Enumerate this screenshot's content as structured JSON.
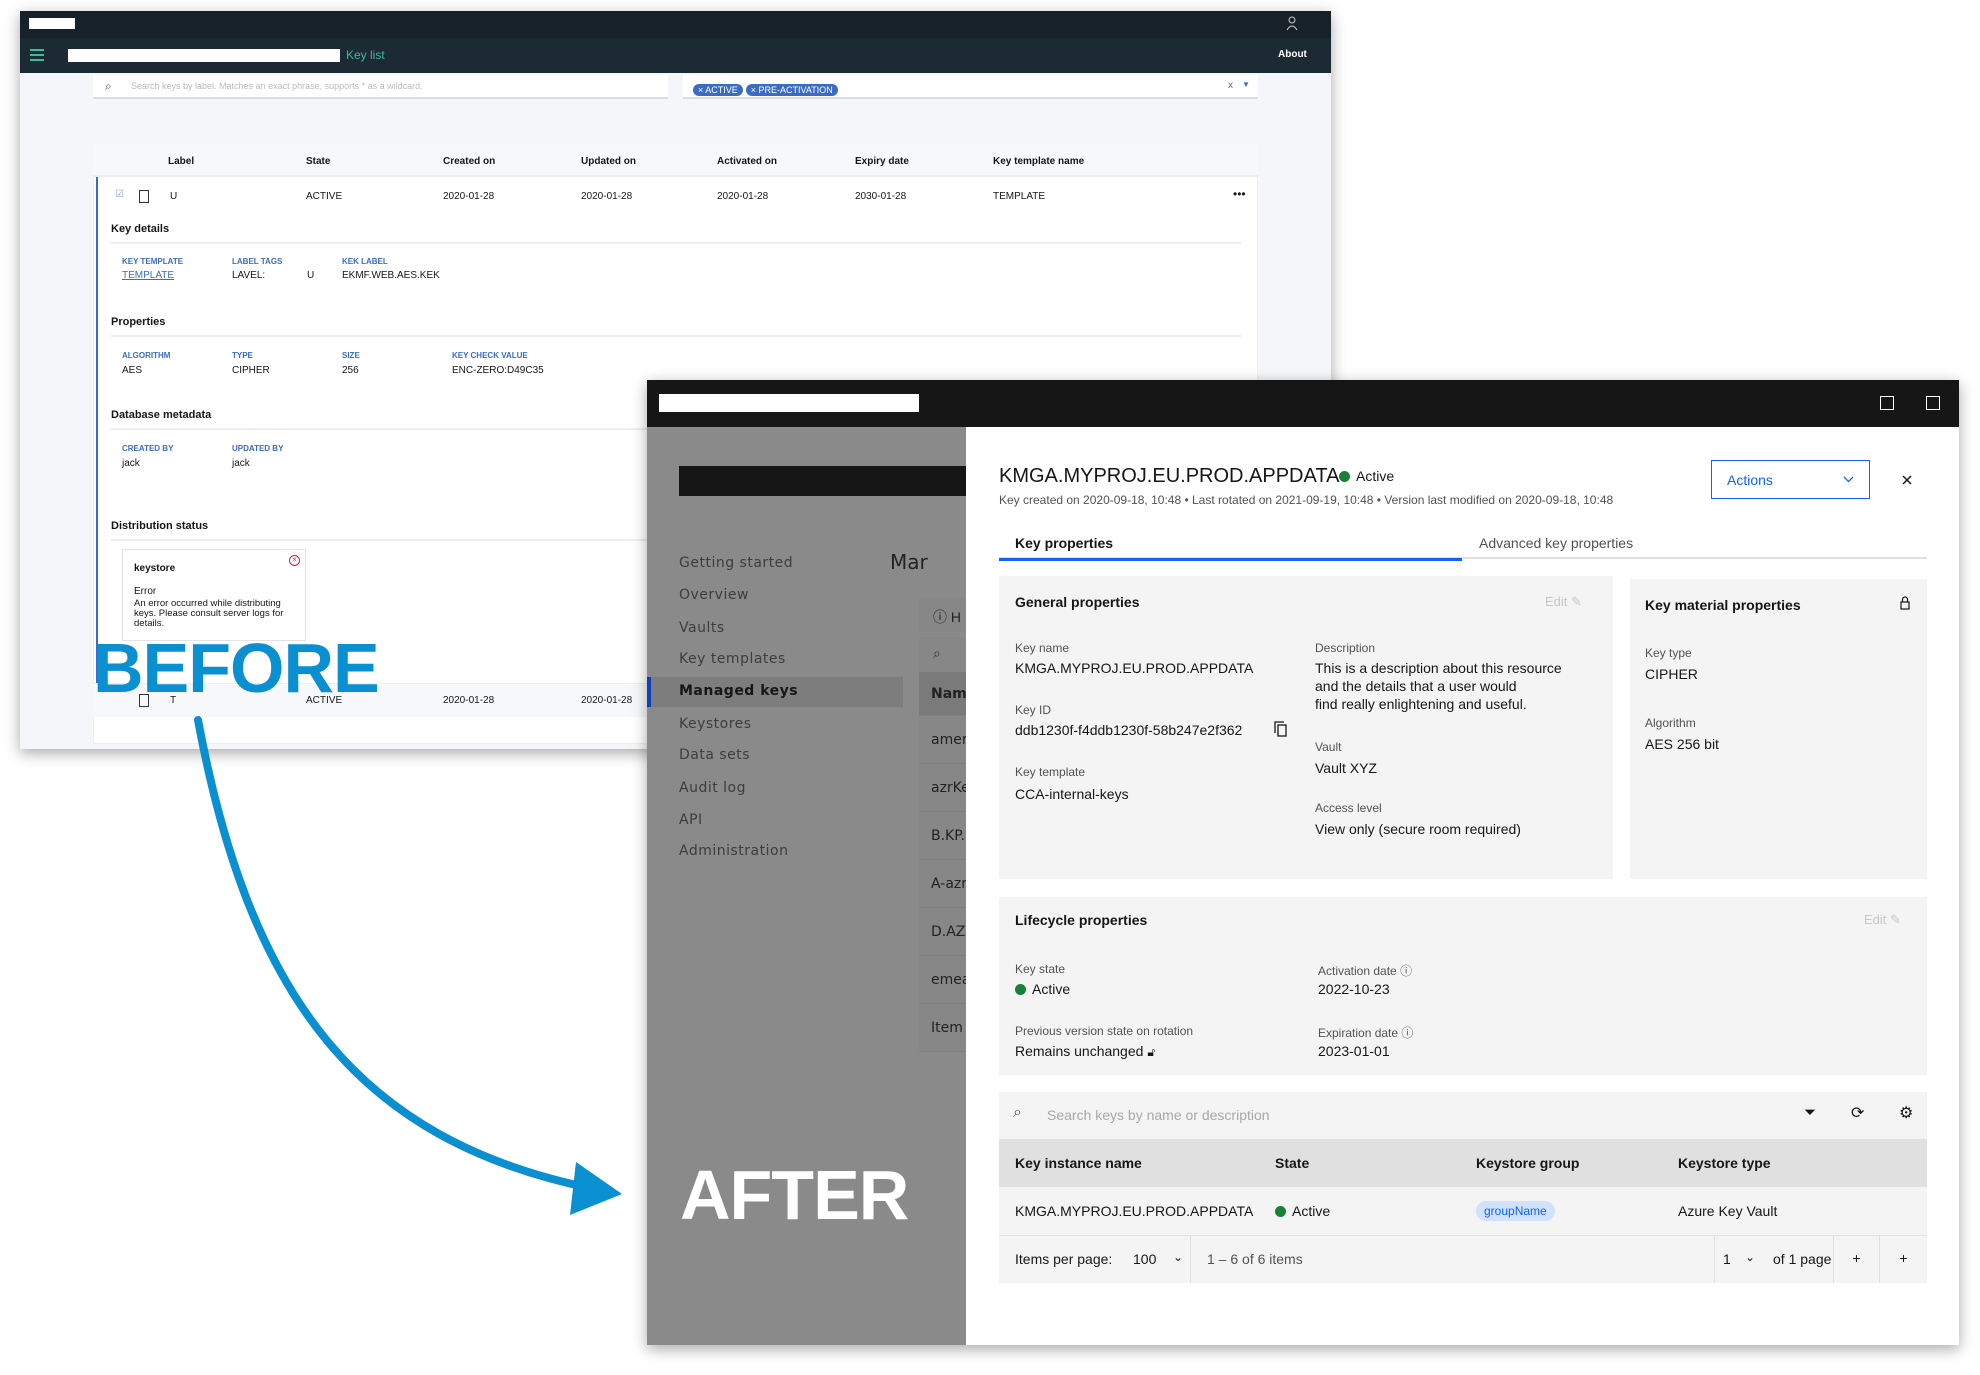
{
  "before": {
    "nav": {
      "title": "Key list",
      "about": "About",
      "icons": [
        "menu-icon",
        "user-icon"
      ]
    },
    "search_placeholder": "Search keys by label. Matches an exact phrase, supports * as a wildcard.",
    "filter_chips": [
      "× ACTIVE",
      "× PRE-ACTIVATION"
    ],
    "filter_clear": "x",
    "columns": [
      "Label",
      "State",
      "Created on",
      "Updated on",
      "Activated on",
      "Expiry date",
      "Key template name"
    ],
    "row": {
      "label": "U",
      "state": "ACTIVE",
      "created": "2020-01-28",
      "updated": "2020-01-28",
      "activated": "2020-01-28",
      "expiry": "2030-01-28",
      "template": "TEMPLATE",
      "menu": "•••"
    },
    "key_details": {
      "title": "Key details",
      "key_template_label": "KEY TEMPLATE",
      "key_template_value": "TEMPLATE",
      "label_tags_label": "LABEL TAGS",
      "label_tags_key": "LAVEL:",
      "label_tags_value": "U",
      "kek_label_label": "KEK LABEL",
      "kek_label_value": "EKMF.WEB.AES.KEK"
    },
    "properties": {
      "title": "Properties",
      "algorithm_label": "ALGORITHM",
      "algorithm": "AES",
      "type_label": "TYPE",
      "type": "CIPHER",
      "size_label": "SIZE",
      "size": "256",
      "kcv_label": "KEY CHECK VALUE",
      "kcv": "ENC-ZERO:D49C35"
    },
    "db_metadata": {
      "title": "Database metadata",
      "created_by_label": "CREATED BY",
      "created_by": "jack",
      "updated_by_label": "UPDATED BY",
      "updated_by": "jack"
    },
    "distribution": {
      "title": "Distribution status",
      "card_title": "keystore",
      "status": "Error",
      "message": "An error occurred while distributing keys. Please consult server logs for details."
    },
    "row2": {
      "label": "T",
      "state": "ACTIVE",
      "created": "2020-01-28",
      "updated": "2020-01-28"
    }
  },
  "labels": {
    "before": "BEFORE",
    "after": "AFTER"
  },
  "colors": {
    "accent": "#0f62fe",
    "annotation": "#0a8fd1",
    "active": "#198038",
    "error": "#da1e28"
  },
  "after": {
    "sidebar": [
      {
        "label": "Getting started"
      },
      {
        "label": "Overview"
      },
      {
        "label": "Vaults"
      },
      {
        "label": "Key templates"
      },
      {
        "label": "Managed keys",
        "active": true
      },
      {
        "label": "Keystores"
      },
      {
        "label": "Data sets"
      },
      {
        "label": "Audit log"
      },
      {
        "label": "API"
      },
      {
        "label": "Administration"
      }
    ],
    "bg": {
      "title": "Mar",
      "info": "H",
      "header": "Name",
      "rows": [
        "amer",
        "azrKe",
        "B.KP.",
        "A-azr",
        "D.AZ",
        "emea",
        "Item"
      ]
    },
    "panel": {
      "title": "KMGA.MYPROJ.EU.PROD.APPDATA",
      "status": "Active",
      "subtitle": "Key created on 2020-09-18, 10:48 • Last rotated on 2021-09-19, 10:48 • Version last modified on 2020-09-18, 10:48",
      "actions": "Actions",
      "tabs": [
        {
          "label": "Key properties",
          "active": true
        },
        {
          "label": "Advanced key properties"
        }
      ],
      "general": {
        "title": "General properties",
        "edit": "Edit",
        "key_name_label": "Key name",
        "key_name": "KMGA.MYPROJ.EU.PROD.APPDATA",
        "key_id_label": "Key ID",
        "key_id": "ddb1230f-f4ddb1230f-58b247e2f362",
        "key_template_label": "Key template",
        "key_template": "CCA-internal-keys",
        "description_label": "Description",
        "description_lines": [
          "This is a description about this resource",
          "and the details that a user would",
          "find really enlightening and useful."
        ],
        "vault_label": "Vault",
        "vault": "Vault XYZ",
        "access_label": "Access level",
        "access": "View only (secure room required)"
      },
      "material": {
        "title": "Key material properties",
        "key_type_label": "Key type",
        "key_type": "CIPHER",
        "algorithm_label": "Algorithm",
        "algorithm": "AES 256 bit"
      },
      "lifecycle": {
        "title": "Lifecycle properties",
        "edit": "Edit",
        "key_state_label": "Key state",
        "key_state": "Active",
        "activation_label": "Activation date",
        "activation": "2022-10-23",
        "prev_label": "Previous version state on rotation",
        "prev": "Remains unchanged",
        "expiration_label": "Expiration date",
        "expiration": "2023-01-01"
      },
      "instances": {
        "search_placeholder": "Search keys by name or description",
        "columns": [
          "Key instance name",
          "State",
          "Keystore group",
          "Keystore type"
        ],
        "rows": [
          {
            "name": "KMGA.MYPROJ.EU.PROD.APPDATA",
            "state": "Active",
            "group": "groupName",
            "type": "Azure Key Vault"
          }
        ],
        "pagination": {
          "items_per_page_label": "Items per page:",
          "items_per_page": "100",
          "range": "1 – 6 of 6 items",
          "page": "1",
          "of_pages": "of 1 page",
          "prev": "+",
          "next": "+"
        }
      }
    }
  }
}
